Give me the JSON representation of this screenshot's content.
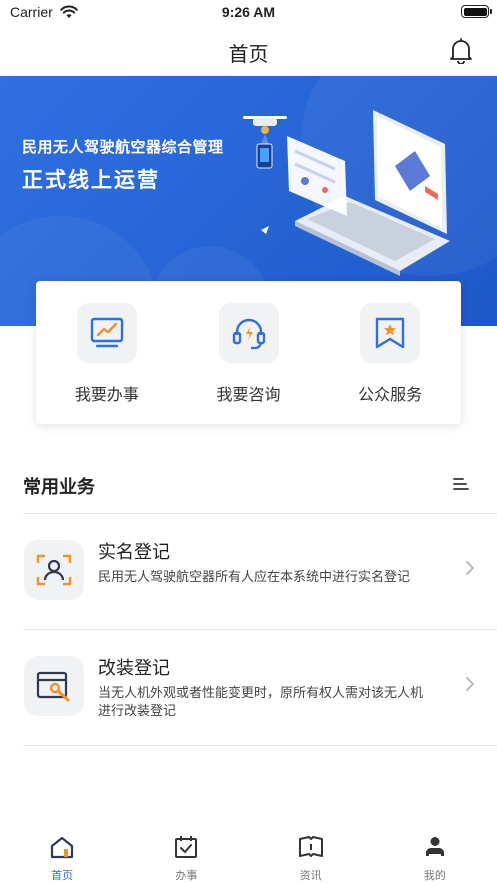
{
  "status_bar": {
    "carrier": "Carrier",
    "time": "9:26 AM",
    "battery_level": 1.0
  },
  "nav": {
    "title": "首页",
    "bell_icon": "bell-icon"
  },
  "banner": {
    "line1": "民用无人驾驶航空器综合管理",
    "line2": "正式线上运营",
    "colors": {
      "primary": "#2766d6",
      "dark": "#1e58c9"
    }
  },
  "quick_actions": [
    {
      "label": "我要办事",
      "icon": "chart-monitor-icon"
    },
    {
      "label": "我要咨询",
      "icon": "headset-icon"
    },
    {
      "label": "公众服务",
      "icon": "bookmark-star-icon"
    }
  ],
  "section": {
    "title": "常用业务",
    "toggle_icon": "list-icon"
  },
  "services": [
    {
      "title": "实名登记",
      "desc": "民用无人驾驶航空器所有人应在本系统中进行实名登记",
      "icon": "scan-user-icon"
    },
    {
      "title": "改装登记",
      "desc": "当无人机外观或者性能变更时，原所有权人需对该无人机进行改装登记",
      "icon": "window-tool-icon"
    }
  ],
  "tabs": [
    {
      "label": "首页",
      "icon": "home-icon",
      "active": true
    },
    {
      "label": "办事",
      "icon": "calendar-check-icon",
      "active": false
    },
    {
      "label": "资讯",
      "icon": "book-icon",
      "active": false
    },
    {
      "label": "我的",
      "icon": "user-icon",
      "active": false
    }
  ],
  "colors": {
    "accent": "#2f6fe0",
    "orange": "#f0932b",
    "icon_bg": "#f1f2f4"
  }
}
